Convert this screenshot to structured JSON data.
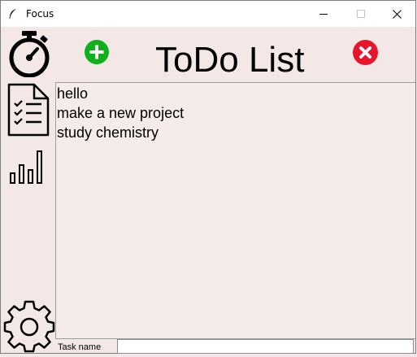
{
  "window": {
    "title": "Focus",
    "icon": "feather-icon"
  },
  "sidebar": {
    "items": [
      {
        "name": "timer",
        "icon": "stopwatch-icon"
      },
      {
        "name": "todo",
        "icon": "checklist-document-icon"
      },
      {
        "name": "stats",
        "icon": "bar-chart-icon"
      },
      {
        "name": "settings",
        "icon": "gear-icon"
      }
    ]
  },
  "header": {
    "title": "ToDo List",
    "add_icon": "plus-circle-icon",
    "delete_icon": "x-circle-icon",
    "colors": {
      "add": "#10b01c",
      "delete": "#e8142c"
    }
  },
  "tasks": [
    "hello",
    "make a new project",
    "study chemistry"
  ],
  "entry": {
    "label": "Task name",
    "value": ""
  }
}
